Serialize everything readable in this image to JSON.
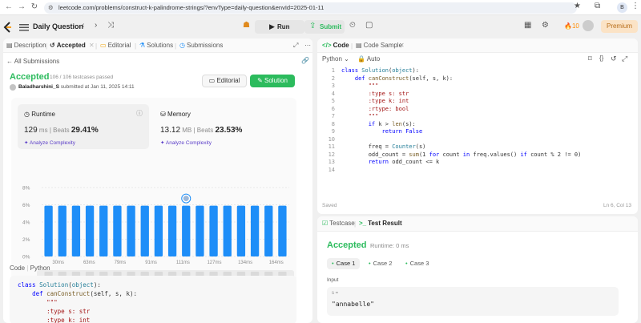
{
  "browser": {
    "url": "leetcode.com/problems/construct-k-palindrome-strings/?envType=daily-question&envId=2025-01-11",
    "profile_initial": "B"
  },
  "appbar": {
    "title": "Daily Question",
    "run_label": "Run",
    "submit_label": "Submit",
    "streak_count": "10",
    "premium_label": "Premium"
  },
  "left_tabs": {
    "description": "Description",
    "accepted": "Accepted",
    "editorial": "Editorial",
    "solutions": "Solutions",
    "submissions": "Submissions"
  },
  "submission": {
    "back_label": "All Submissions",
    "status": "Accepted",
    "testcases": "106 / 106 testcases passed",
    "username": "Baladharshini_S",
    "submitted_text": "submitted at Jan 11, 2025 14:11",
    "editorial_btn": "Editorial",
    "solution_btn": "Solution"
  },
  "runtime": {
    "label": "Runtime",
    "value": "129",
    "unit": "ms",
    "beats_label": "Beats",
    "beats": "29.41%",
    "analyze": "Analyze Complexity"
  },
  "memory": {
    "label": "Memory",
    "value": "13.12",
    "unit": "MB",
    "beats_label": "Beats",
    "beats": "23.53%",
    "analyze": "Analyze Complexity"
  },
  "chart_data": {
    "type": "bar",
    "ytick_labels": [
      "8%",
      "6%",
      "4%",
      "2%",
      "0%"
    ],
    "ylim": [
      0,
      8
    ],
    "values": [
      5.9,
      5.9,
      5.9,
      5.9,
      5.9,
      5.9,
      5.9,
      5.9,
      5.9,
      5.9,
      5.9,
      5.9,
      5.9,
      5.9,
      5.9,
      5.9,
      5.9,
      5.9
    ],
    "xtick_labels": [
      "30ms",
      "63ms",
      "79ms",
      "91ms",
      "111ms",
      "127ms",
      "134ms",
      "164ms"
    ],
    "bar_color": "#1e8ef8",
    "marker_index": 10
  },
  "left_code": {
    "header": "Code",
    "lang": "Python"
  },
  "editor": {
    "tab_code": "Code",
    "tab_sample": "Code Sample",
    "lang": "Python",
    "mode": "Auto",
    "saved": "Saved",
    "position": "Ln 6, Col 13",
    "line_numbers": [
      "1",
      "2",
      "3",
      "4",
      "5",
      "6",
      "7",
      "8",
      "9",
      "10",
      "11",
      "12",
      "13",
      "14"
    ]
  },
  "test": {
    "tab_testcase": "Testcase",
    "tab_result": "Test Result",
    "status": "Accepted",
    "runtime": "Runtime: 0 ms",
    "cases": [
      "Case 1",
      "Case 2",
      "Case 3"
    ],
    "input_label": "Input",
    "var": "s =",
    "value": "\"annabelle\""
  },
  "colors": {
    "accent_green": "#2cbb5d",
    "bar_blue": "#1e8ef8",
    "premium": "#b86e1a"
  }
}
